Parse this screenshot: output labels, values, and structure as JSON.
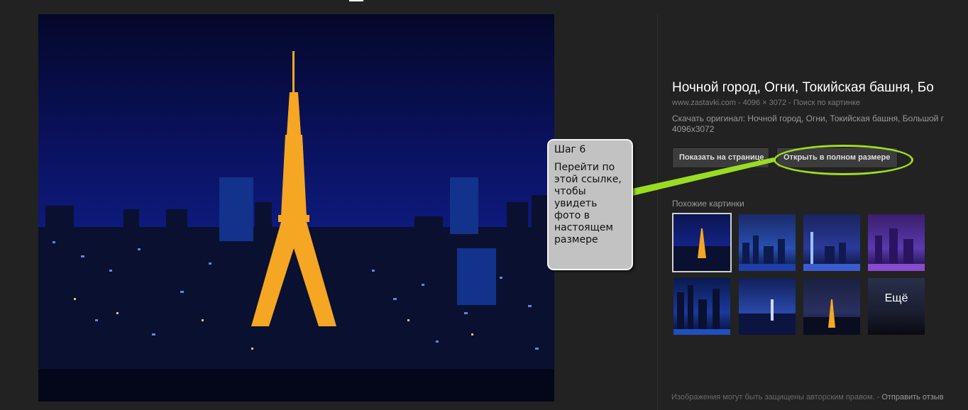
{
  "image_title": "Ночной город, Огни, Токийская башня, Бо",
  "meta": {
    "source": "www.zastavki.com",
    "separator": " - ",
    "dimensions": "4096 × 3072",
    "search_link": "Поиск по картинке"
  },
  "description_line1": "Скачать оригинал: Ночной город, Огни, Токийская башня, Большой г",
  "description_line2": "4096x3072",
  "buttons": {
    "show_on_page": "Показать на странице",
    "open_full_size": "Открыть в полном размере"
  },
  "similar": {
    "label": "Похожие картинки",
    "more_label": "Ещё"
  },
  "callout": {
    "step": "Шаг 6",
    "text": "Перейти по этой ссылке, чтобы увидеть фото в настоящем размере"
  },
  "footer": {
    "copyright": "Изображения могут быть защищены авторским правом.",
    "separator": " - ",
    "feedback": "Отправить отзыв"
  },
  "colors": {
    "background": "#222222",
    "callout_arrow": "#99dd22",
    "tower": "#f5a623"
  }
}
